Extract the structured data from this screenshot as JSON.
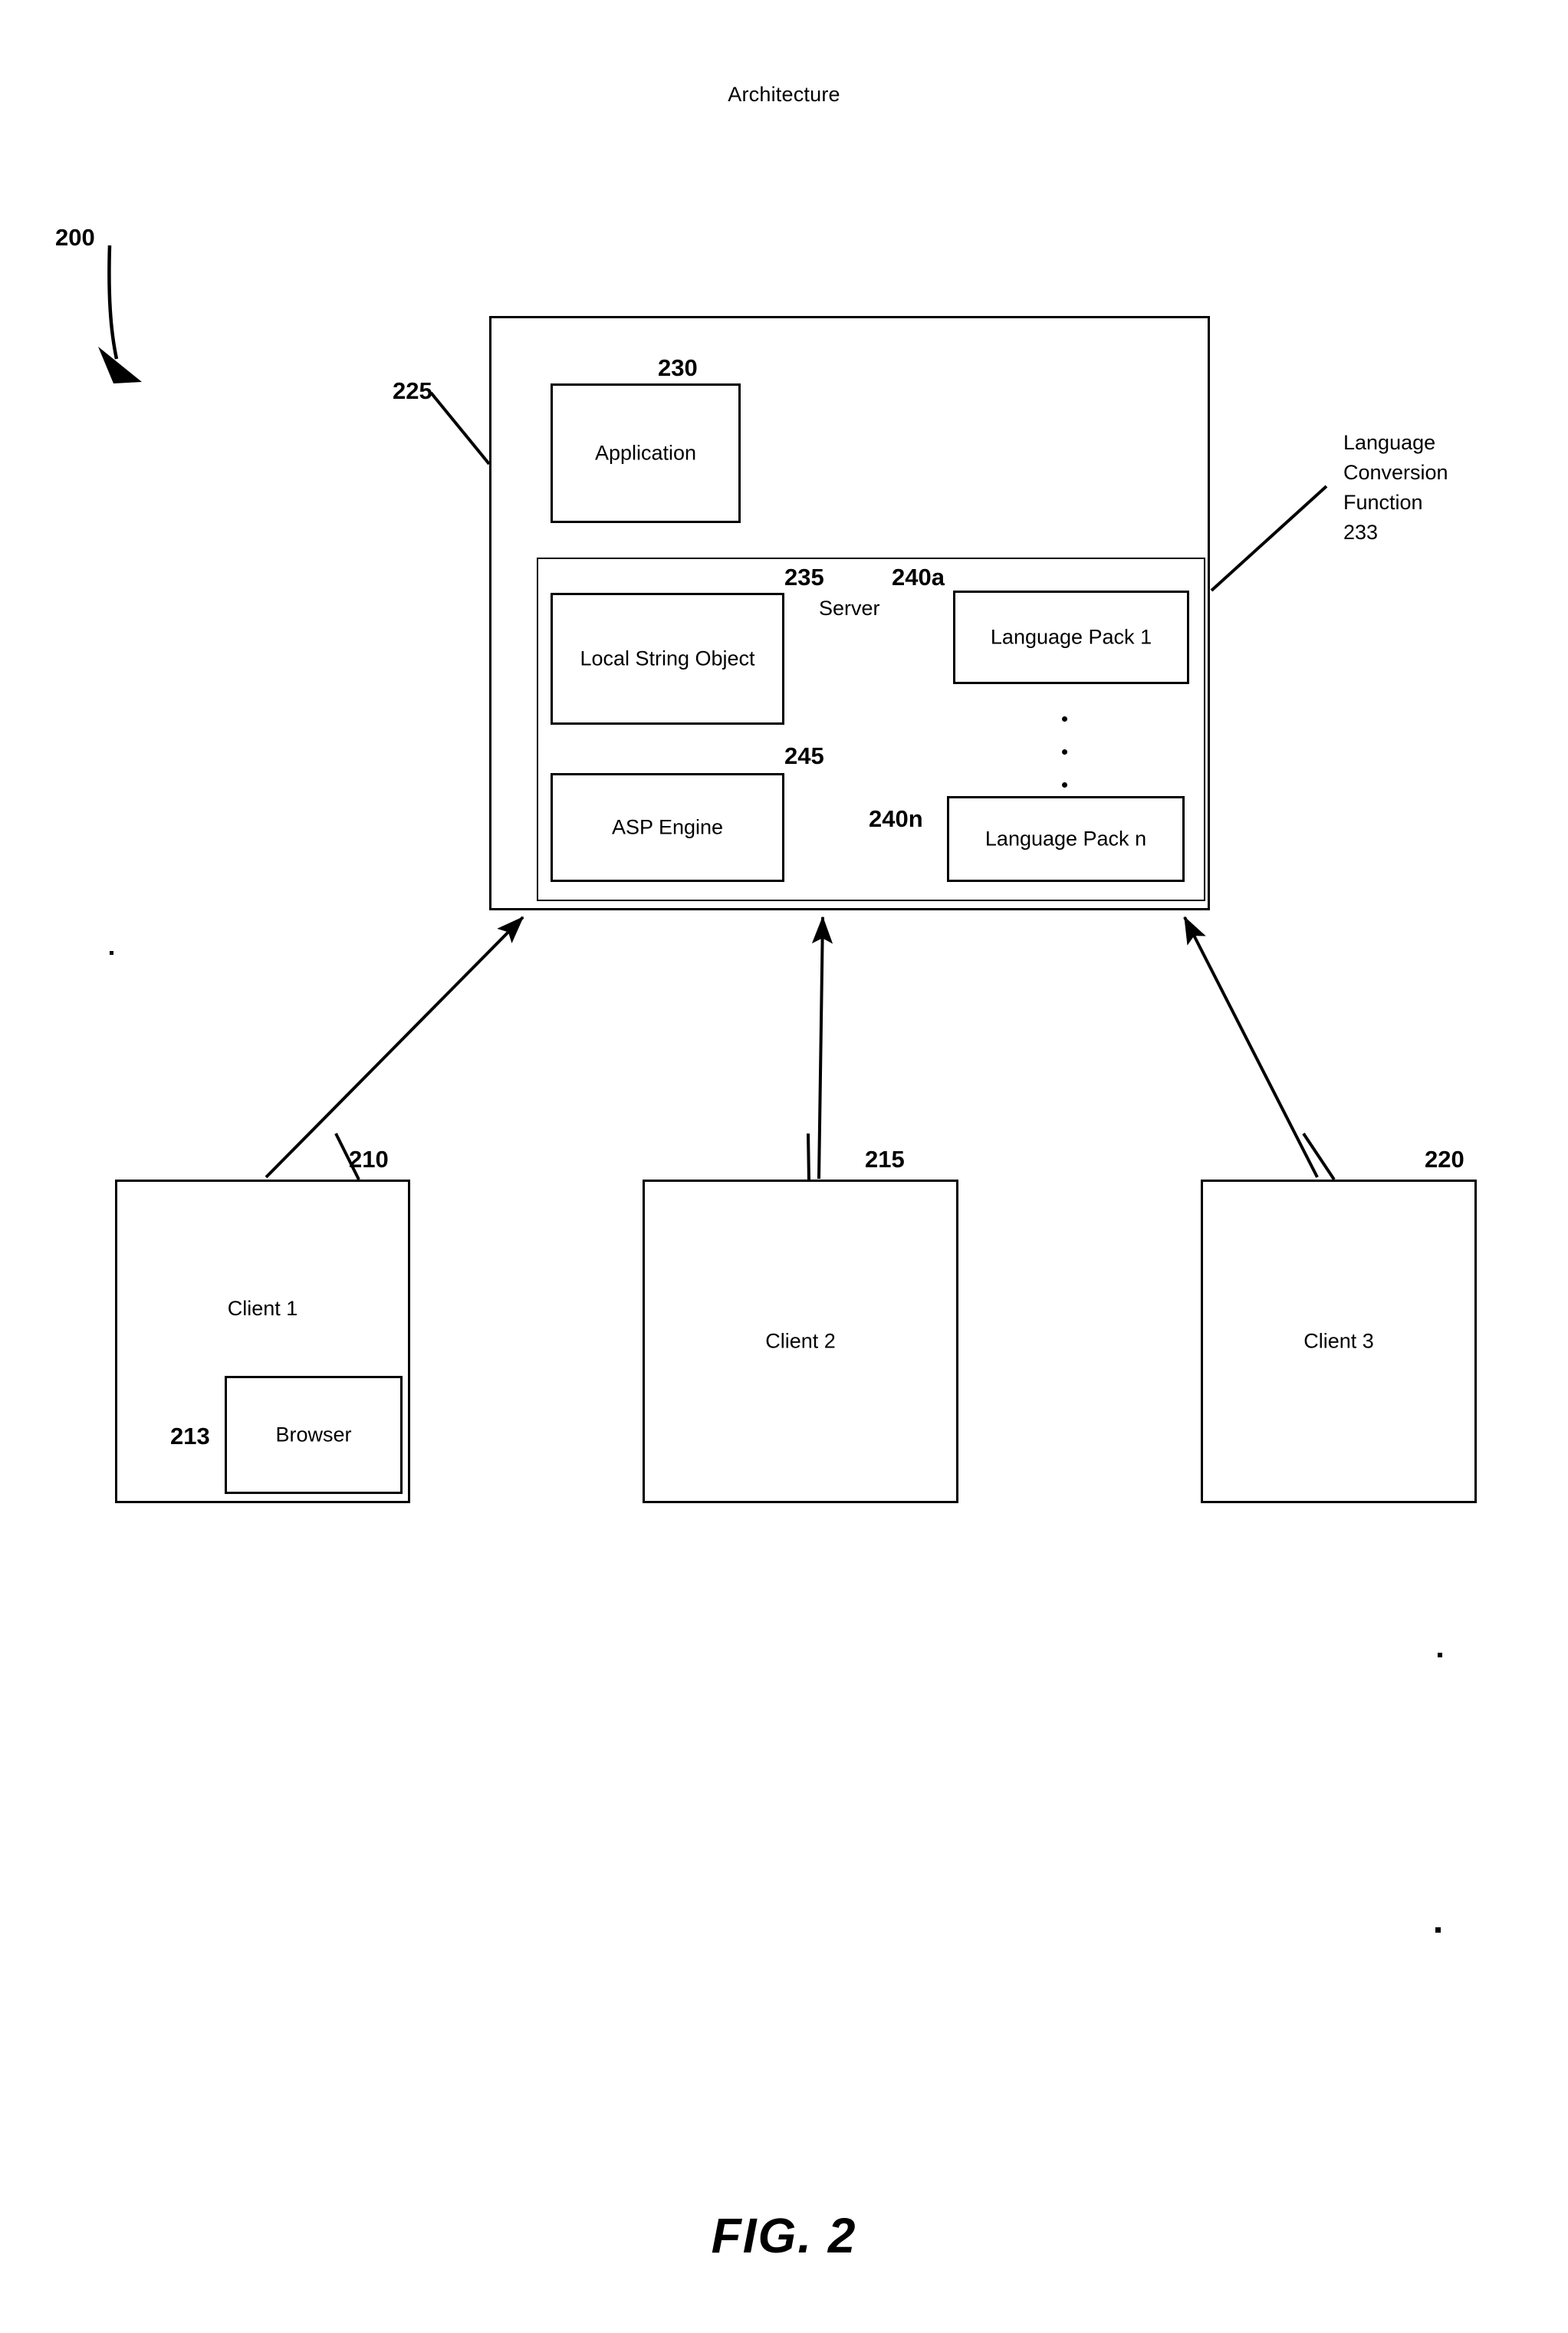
{
  "document": {
    "header": "Architecture",
    "figure_caption": "FIG. 2"
  },
  "diagram": {
    "system_ref": "200",
    "server_outer": {
      "ref": "225"
    },
    "application": {
      "label": "Application",
      "ref": "230"
    },
    "server_inner": {
      "label": "Server",
      "ref": "235"
    },
    "local_string_object": {
      "label": "Local String Object"
    },
    "asp_engine": {
      "label": "ASP Engine",
      "ref": "245"
    },
    "language_pack_1": {
      "label": "Language Pack 1",
      "ref": "240a"
    },
    "language_pack_n": {
      "label": "Language Pack n",
      "ref": "240n"
    },
    "language_conversion_callout": {
      "text": "Language\nConversion\nFunction\n233"
    },
    "clients": [
      {
        "label": "Client 1",
        "ref": "210",
        "child": {
          "label": "Browser",
          "ref": "213"
        }
      },
      {
        "label": "Client 2",
        "ref": "215"
      },
      {
        "label": "Client 3",
        "ref": "220"
      }
    ]
  },
  "colors": {
    "ink": "#000000",
    "paper": "#ffffff"
  }
}
